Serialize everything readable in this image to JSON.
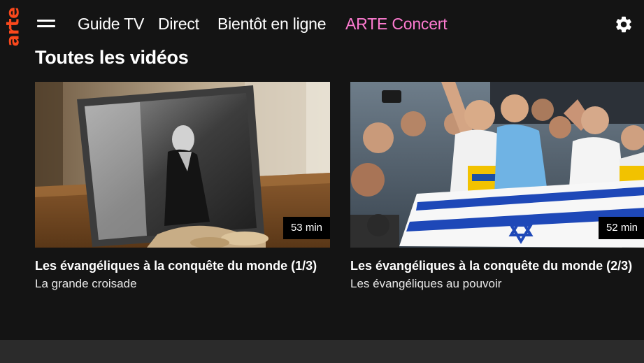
{
  "brand": {
    "logo_text": "arte",
    "logo_color": "#fa481c",
    "accent_color": "#fd7bd0"
  },
  "header": {
    "menu_icon": "hamburger-menu-icon",
    "nav": [
      {
        "label": "Guide TV"
      },
      {
        "label": "Direct"
      },
      {
        "label": "Bientôt en ligne"
      },
      {
        "label": "ARTE Concert",
        "accent": true
      }
    ],
    "settings_icon": "gear-icon"
  },
  "section": {
    "title": "Toutes les vidéos",
    "videos": [
      {
        "title": "Les évangéliques à la conquête du monde (1/3)",
        "subtitle": "La grande croisade",
        "duration": "53 min",
        "thumbnail": "framed black-and-white photo of a preacher on a wooden table"
      },
      {
        "title": "Les évangéliques à la conquête du monde (2/3)",
        "subtitle": "Les évangéliques au pouvoir",
        "duration": "52 min",
        "thumbnail": "crowd rally with a raised-arm speaker and an Israeli flag"
      }
    ]
  }
}
